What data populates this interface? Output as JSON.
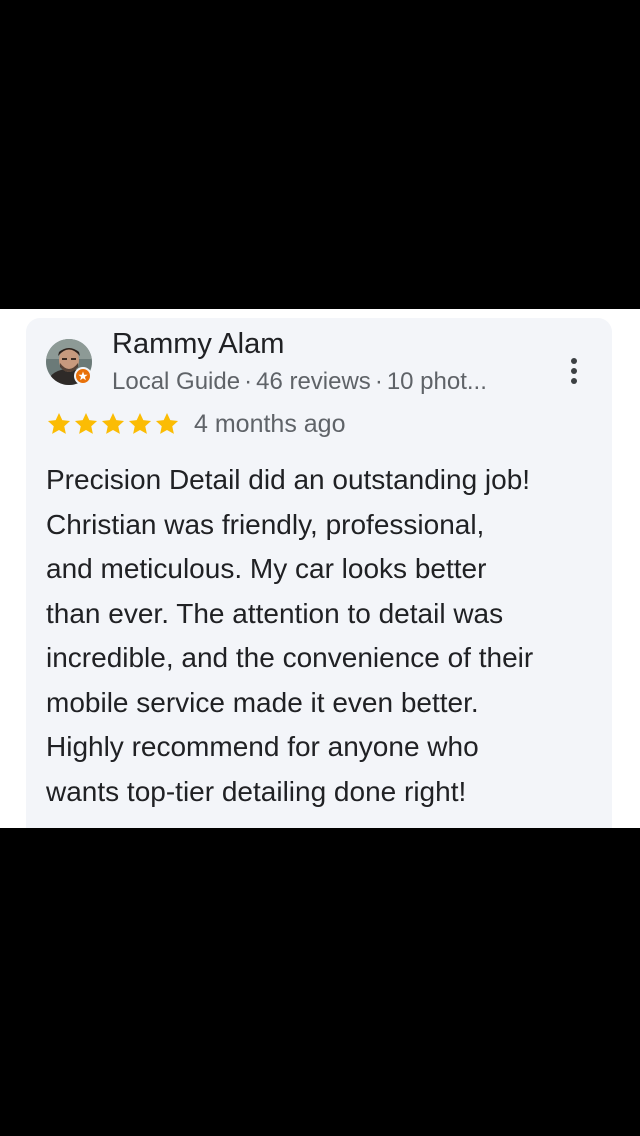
{
  "review": {
    "reviewer_name": "Rammy Alam",
    "reviewer_level": "Local Guide",
    "separator": "·",
    "review_count": "46 reviews",
    "photo_count": "10 phot...",
    "rating": 5,
    "rating_max": 5,
    "date": "4 months ago",
    "text_lines": [
      "Precision Detail did an outstanding job!",
      "Christian was friendly, professional,",
      "and meticulous. My car looks better",
      "than ever. The attention to detail was",
      "incredible, and the convenience of their",
      "mobile service made it even better.",
      "Highly recommend for anyone who",
      "wants top-tier detailing done right!"
    ]
  },
  "icons": {
    "avatar": "user-avatar-photo",
    "badge": "local-guide-star-badge",
    "menu": "more-vertical-icon",
    "star": "star-filled-icon"
  },
  "colors": {
    "star": "#fbbc04",
    "badge": "#e8710a",
    "card_background": "#f3f5f9",
    "primary_text": "#202124",
    "secondary_text": "#5f6368"
  }
}
